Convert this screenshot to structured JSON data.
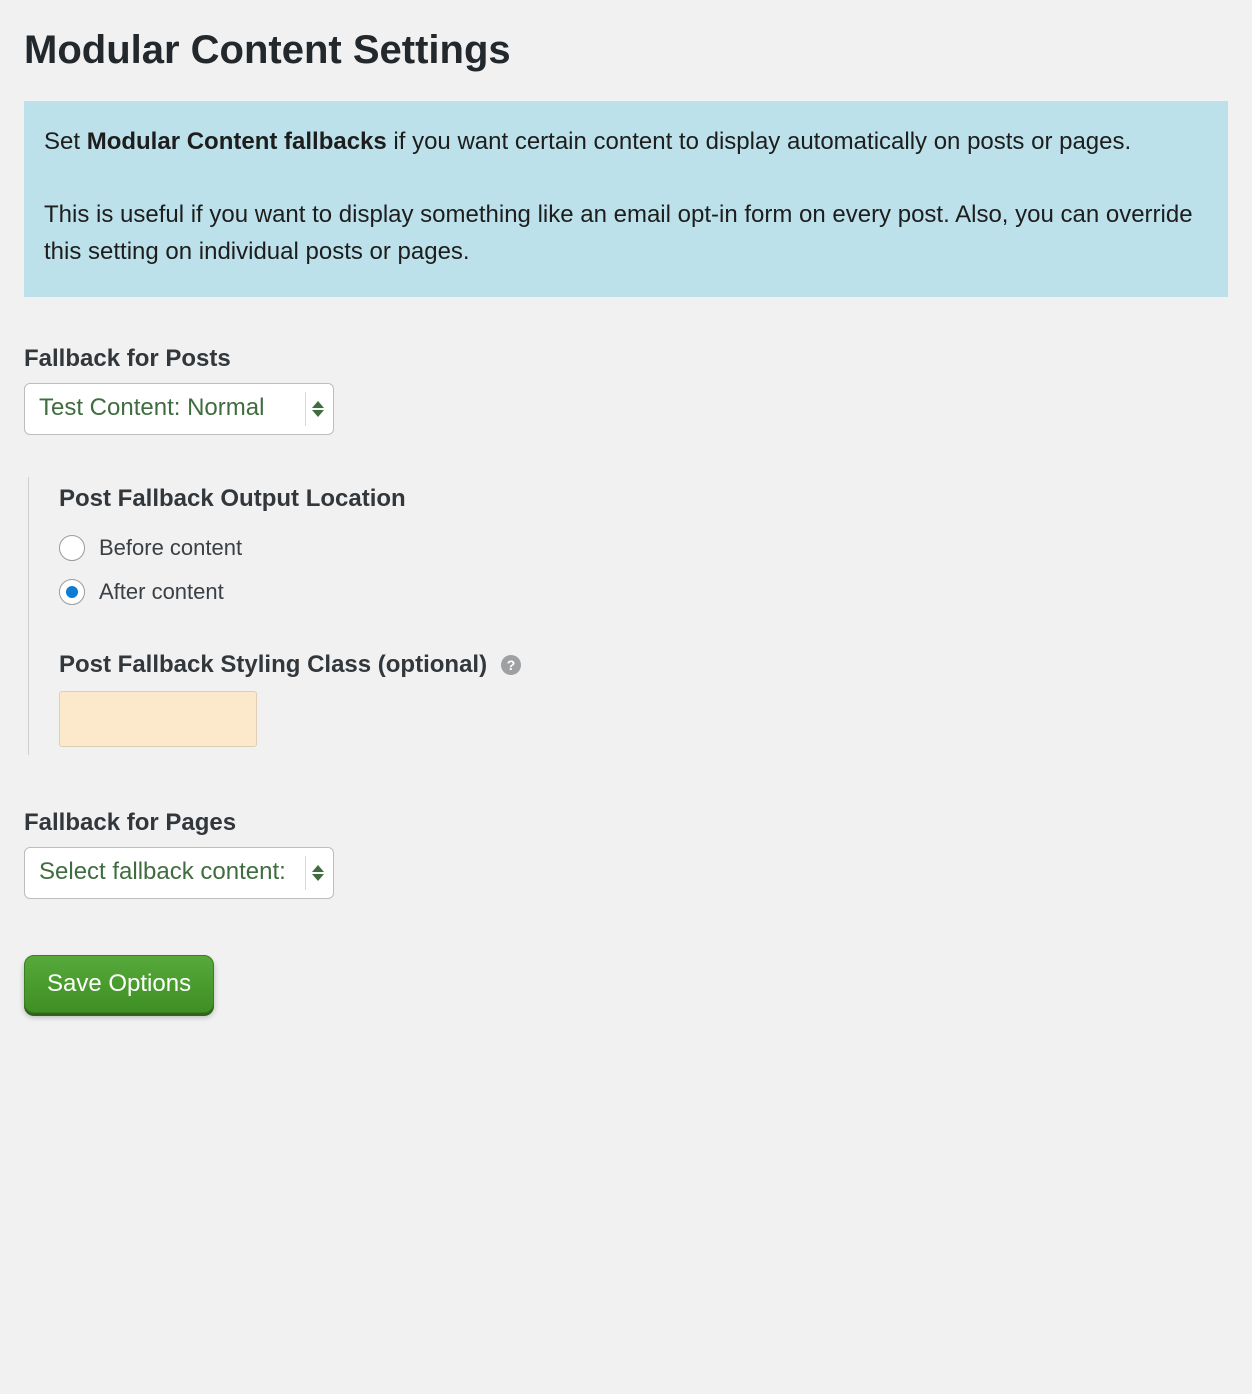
{
  "page": {
    "title": "Modular Content Settings"
  },
  "info": {
    "p1_prefix": "Set ",
    "p1_bold": "Modular Content fallbacks",
    "p1_suffix": " if you want certain content to display automatically on posts or pages.",
    "p2": "This is useful if you want to display something like an email opt-in form on every post. Also, you can override this setting on individual posts or pages."
  },
  "posts": {
    "label": "Fallback for Posts",
    "selected": "Test Content: Normal",
    "output_location_heading": "Post Fallback Output Location",
    "radio_before": "Before content",
    "radio_after": "After content",
    "radio_selected": "after",
    "styling_heading": "Post Fallback Styling Class (optional)",
    "help_symbol": "?",
    "styling_value": ""
  },
  "pages": {
    "label": "Fallback for Pages",
    "selected": "Select fallback content:"
  },
  "actions": {
    "save": "Save Options"
  }
}
